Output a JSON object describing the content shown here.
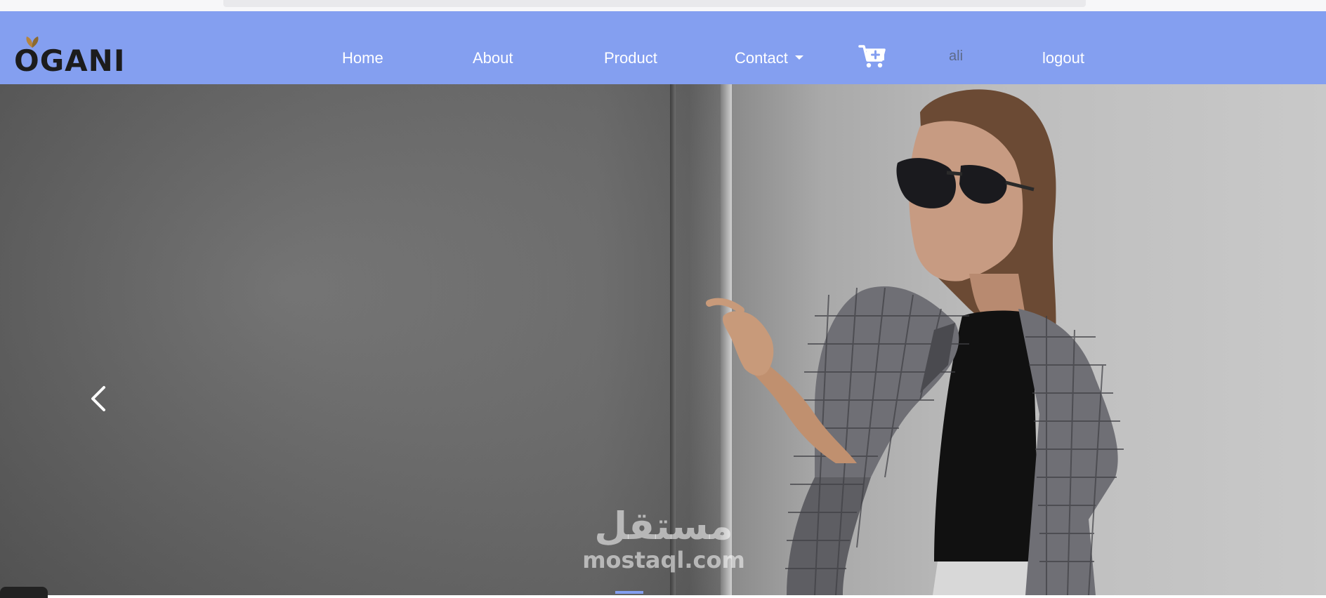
{
  "brand": {
    "logo_text": "OGANI",
    "logo_icon": "leaf-icon",
    "accent": "#849ff0"
  },
  "nav": {
    "links": [
      {
        "label": "Home"
      },
      {
        "label": "About"
      },
      {
        "label": "Product"
      },
      {
        "label": "Contact"
      }
    ],
    "cart_icon": "cart-plus-icon",
    "user": "ali",
    "logout_label": "logout"
  },
  "hero": {
    "prev_icon": "chevron-left-icon",
    "watermark_ar": "مستقل",
    "watermark_en": "mostaql.com"
  }
}
